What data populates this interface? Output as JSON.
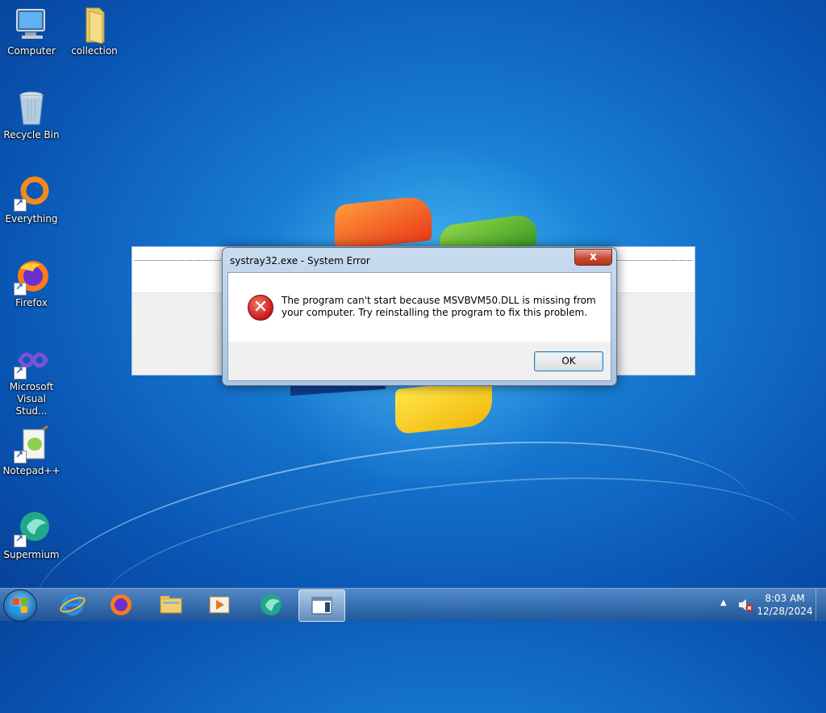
{
  "desktop": {
    "icons": [
      {
        "label": "Computer",
        "icon": "computer-icon",
        "shortcut": false
      },
      {
        "label": "collection",
        "icon": "folder-icon",
        "shortcut": false
      },
      {
        "label": "Recycle Bin",
        "icon": "recycle-bin-icon",
        "shortcut": false
      },
      {
        "label": "Everything",
        "icon": "everything-icon",
        "shortcut": true
      },
      {
        "label": "Firefox",
        "icon": "firefox-icon",
        "shortcut": true
      },
      {
        "label": "Microsoft Visual Stud...",
        "icon": "visual-studio-icon",
        "shortcut": true
      },
      {
        "label": "Notepad++",
        "icon": "notepadpp-icon",
        "shortcut": true
      },
      {
        "label": "Supermium",
        "icon": "supermium-icon",
        "shortcut": true
      }
    ]
  },
  "dialog": {
    "title": "systray32.exe - System Error",
    "close_label": "x",
    "icon": "error-icon",
    "error_glyph": "✕",
    "message": "The program can't start because MSVBVM50.DLL is missing from your computer. Try reinstalling the program to fix this problem.",
    "ok_label": "OK"
  },
  "taskbar": {
    "items": [
      {
        "icon": "internet-explorer-icon"
      },
      {
        "icon": "firefox-icon"
      },
      {
        "icon": "file-explorer-icon"
      },
      {
        "icon": "media-player-icon"
      },
      {
        "icon": "supermium-icon"
      },
      {
        "icon": "app-window-icon",
        "active": true
      }
    ],
    "tray": {
      "overflow_arrow": "▲",
      "clock_time": "8:03 AM",
      "clock_date": "12/28/2024"
    }
  },
  "colors": {
    "desktop_blue": "#1678d0",
    "error_red": "#c8181a",
    "close_red": "#c94a31"
  }
}
